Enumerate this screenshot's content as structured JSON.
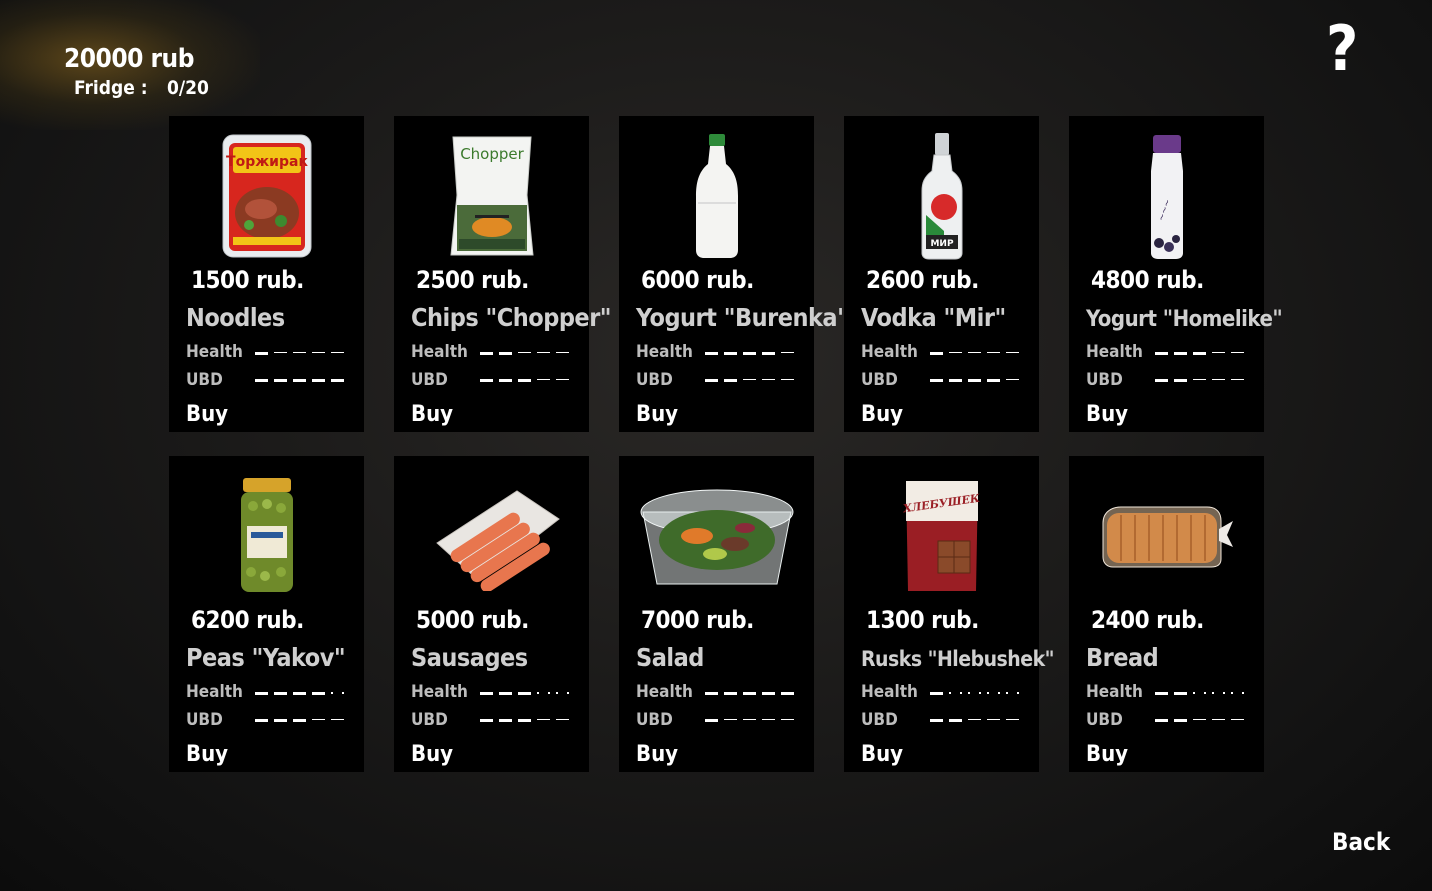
{
  "hud": {
    "money": "20000 rub",
    "fridge_label": "Fridge :",
    "fridge_value": "0/20"
  },
  "help_label": "?",
  "back_label": "Back",
  "stat_labels": {
    "health": "Health",
    "ubd": "UBD"
  },
  "buy_label": "Buy",
  "items": [
    {
      "price": "1500 rub.",
      "name": "Noodles",
      "icon": "noodle-pack-icon",
      "health": [
        2,
        1,
        1,
        1,
        1
      ],
      "ubd": [
        2,
        2,
        2,
        2,
        2
      ]
    },
    {
      "price": "2500 rub.",
      "name": "Chips \"Chopper\"",
      "icon": "chips-bag-icon",
      "health": [
        2,
        2,
        1,
        1,
        1
      ],
      "ubd": [
        2,
        2,
        2,
        1,
        1
      ]
    },
    {
      "price": "6000 rub.",
      "name": "Yogurt \"Burenka\"",
      "icon": "milk-bottle-icon",
      "health": [
        2,
        2,
        2,
        2,
        1
      ],
      "ubd": [
        2,
        2,
        1,
        1,
        1
      ]
    },
    {
      "price": "2600 rub.",
      "name": "Vodka \"Mir\"",
      "icon": "vodka-bottle-icon",
      "health": [
        2,
        1,
        1,
        1,
        1
      ],
      "ubd": [
        2,
        2,
        2,
        2,
        1
      ]
    },
    {
      "price": "4800 rub.",
      "name": "Yogurt \"Homelike\"",
      "icon": "yogurt-bottle-icon",
      "health": [
        2,
        2,
        2,
        1,
        1
      ],
      "ubd": [
        2,
        2,
        1,
        1,
        1
      ]
    },
    {
      "price": "6200 rub.",
      "name": "Peas \"Yakov\"",
      "icon": "peas-jar-icon",
      "health": [
        2,
        2,
        2,
        2,
        0
      ],
      "ubd": [
        2,
        2,
        2,
        1,
        1
      ]
    },
    {
      "price": "5000 rub.",
      "name": "Sausages",
      "icon": "sausages-tray-icon",
      "health": [
        2,
        2,
        2,
        0,
        0
      ],
      "ubd": [
        2,
        2,
        2,
        1,
        1
      ]
    },
    {
      "price": "7000 rub.",
      "name": "Salad",
      "icon": "salad-box-icon",
      "health": [
        2,
        2,
        2,
        2,
        2
      ],
      "ubd": [
        2,
        1,
        1,
        1,
        1
      ]
    },
    {
      "price": "1300 rub.",
      "name": "Rusks \"Hlebushek\"",
      "icon": "rusks-pack-icon",
      "health": [
        2,
        0,
        0,
        0,
        0
      ],
      "ubd": [
        2,
        2,
        1,
        1,
        1
      ]
    },
    {
      "price": "2400 rub.",
      "name": "Bread",
      "icon": "bread-loaf-icon",
      "health": [
        2,
        2,
        0,
        0,
        0
      ],
      "ubd": [
        2,
        2,
        1,
        1,
        1
      ]
    }
  ],
  "product_text": {
    "noodles": "Торжирак",
    "chips": "Chopper",
    "vodka": "МИР",
    "rusks": "ХЛЕБУШЕК"
  }
}
